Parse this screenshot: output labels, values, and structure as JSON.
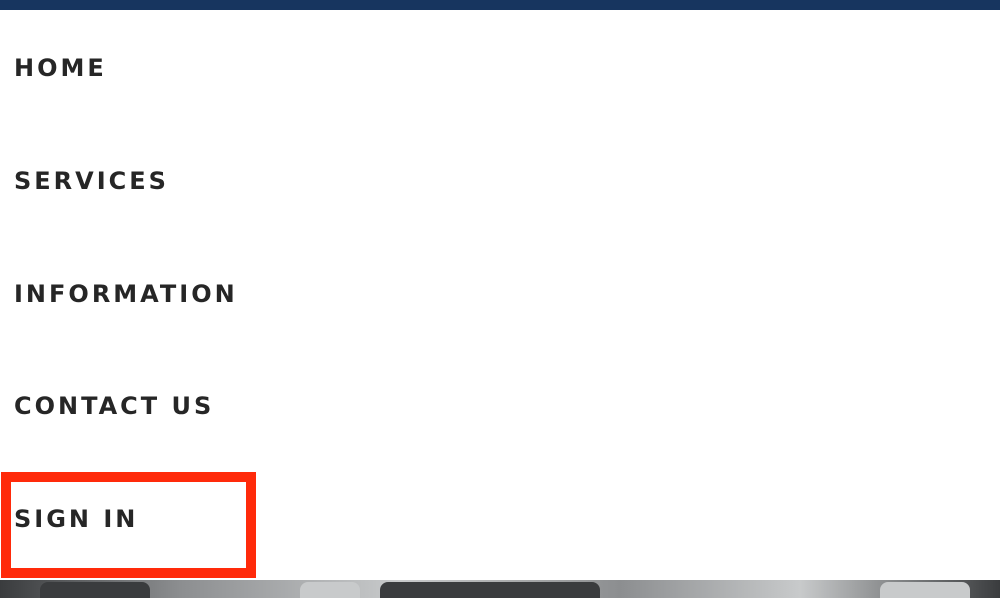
{
  "colors": {
    "top_bar": "#17355f",
    "nav_text": "#262626",
    "highlight": "#ff2a0a",
    "hero_base": "#8c8e90",
    "hero_dark": "#3a3c3e",
    "hero_light": "#c8cacb"
  },
  "nav": {
    "items": [
      {
        "label": "HOME"
      },
      {
        "label": "SERVICES"
      },
      {
        "label": "INFORMATION"
      },
      {
        "label": "CONTACT US"
      },
      {
        "label": "SIGN IN"
      }
    ]
  }
}
